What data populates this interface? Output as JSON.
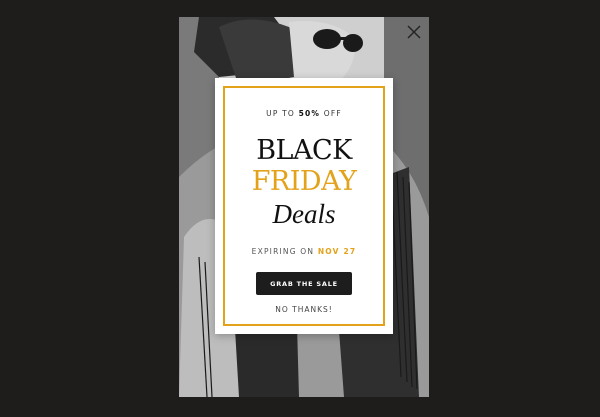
{
  "popup": {
    "kicker_prefix": "UP TO ",
    "kicker_amount": "50%",
    "kicker_suffix": " OFF",
    "headline_line1": "BLACK",
    "headline_line2": "FRIDAY",
    "headline_line3": "Deals",
    "expiring_label": "EXPIRING ON ",
    "expiring_date": "NOV 27",
    "cta_label": "GRAB THE SALE",
    "dismiss_label": "NO THANKS!"
  },
  "icons": {
    "close": "close-icon"
  },
  "colors": {
    "accent": "#e3a21a",
    "background": "#1f1d1b",
    "button": "#1d1d1d",
    "card": "#ffffff"
  }
}
